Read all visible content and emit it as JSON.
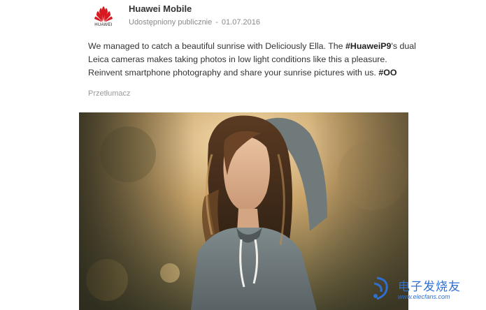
{
  "post": {
    "author": "Huawei Mobile",
    "visibility": "Udostępniony publicznie",
    "separator": "-",
    "date": "01.07.2016",
    "avatar_icon": "huawei-logo-icon",
    "avatar_wordmark": "HUAWEI",
    "text_parts": {
      "p1": "We managed to catch a beautiful sunrise with Deliciously Ella. The ",
      "hashtag1": "#HuaweiP9",
      "p2": "'s dual Leica cameras makes taking photos in low light conditions like this a pleasure. Reinvent smartphone photography and share your sunrise pictures with us. ",
      "hashtag2": "#OO"
    },
    "translate_label": "Przetłumacz",
    "photo_icon": "woman-in-sunrise-photo"
  },
  "watermark": {
    "title": "电子发烧友",
    "url": "www.elecfans.com",
    "icon": "elecfans-logo-icon"
  },
  "colors": {
    "accent": "#2f6fd1",
    "huawei_red": "#d71920"
  }
}
